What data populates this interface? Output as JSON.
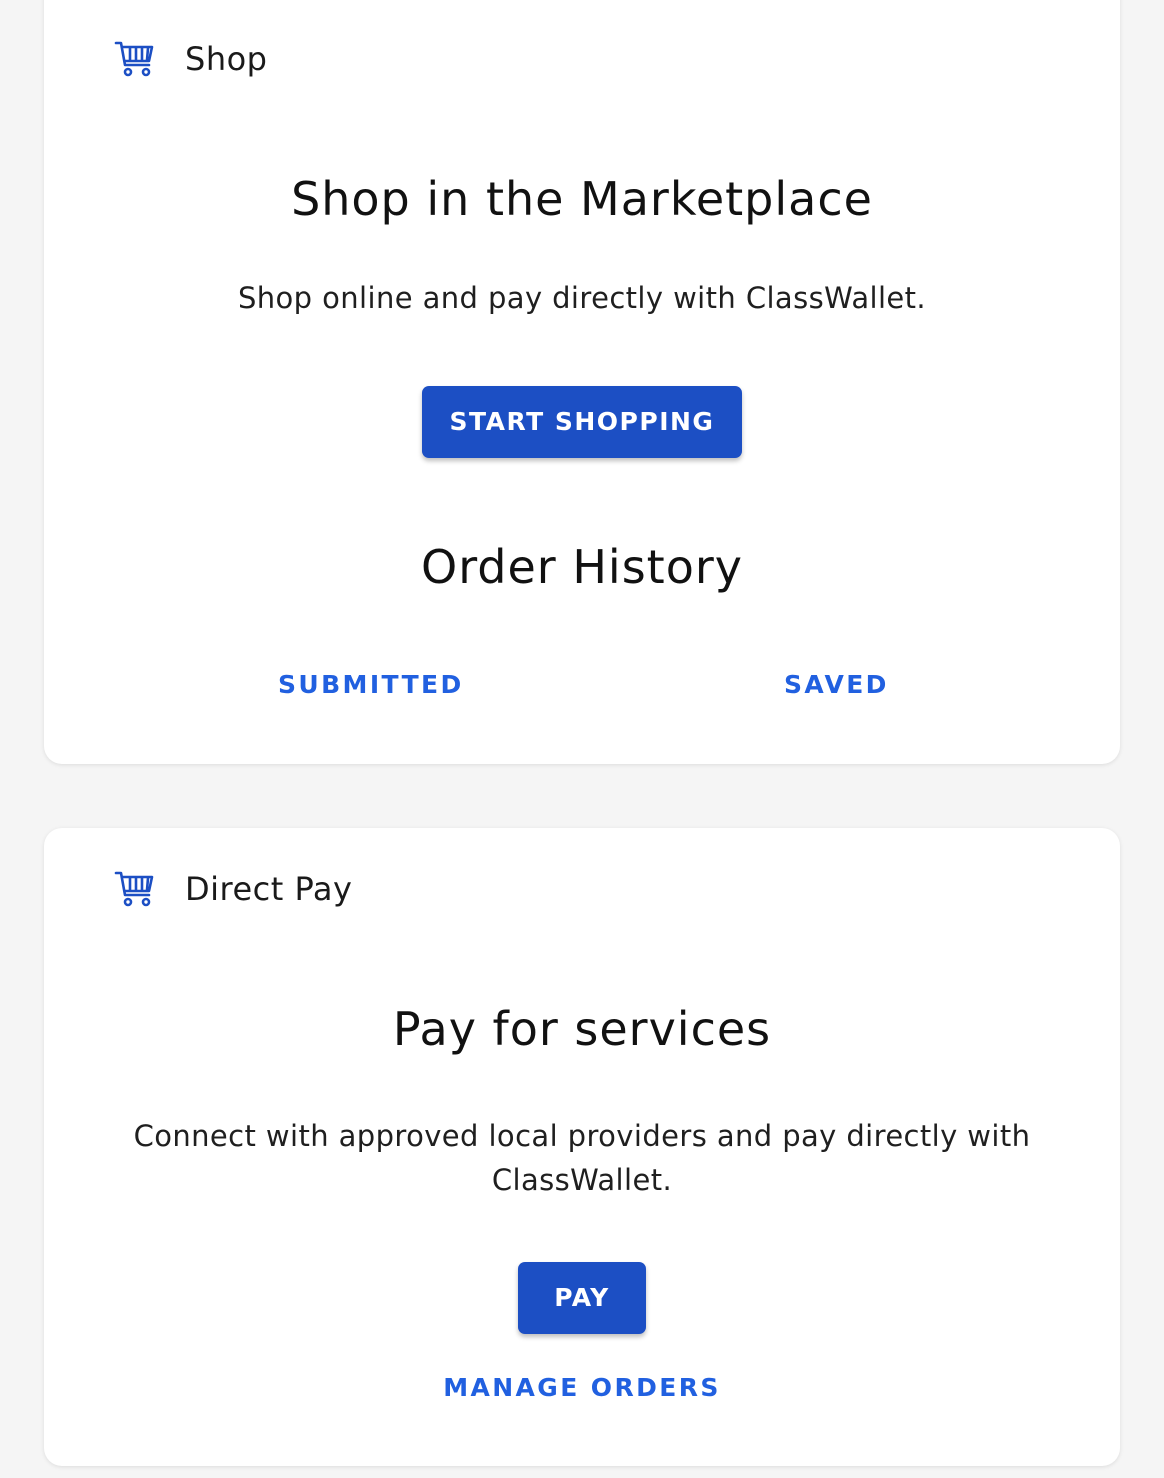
{
  "shop_card": {
    "title": "Shop",
    "icon": "cart-icon",
    "heading": "Shop in the Marketplace",
    "description": "Shop online and pay directly with ClassWallet.",
    "start_button": "START SHOPPING",
    "order_history": {
      "heading": "Order History",
      "submitted_label": "SUBMITTED",
      "saved_label": "SAVED"
    }
  },
  "direct_pay_card": {
    "title": "Direct Pay",
    "icon": "cart-icon",
    "heading": "Pay for services",
    "description": "Connect with approved local providers and pay directly with ClassWallet.",
    "pay_button": "PAY",
    "manage_orders_label": "MANAGE ORDERS"
  },
  "colors": {
    "accent": "#1c4fc4",
    "link": "#2160e0",
    "background": "#f5f5f5",
    "card": "#ffffff"
  }
}
